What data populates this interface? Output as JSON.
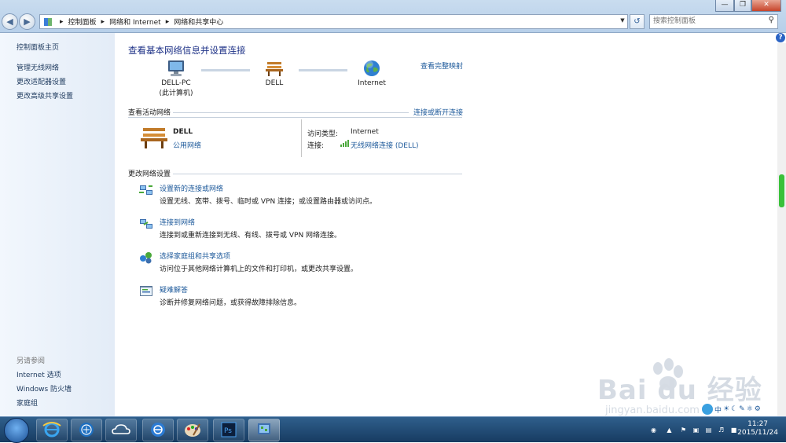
{
  "window": {
    "title_blurred": "网络和共享中心",
    "controls": [
      "—",
      "❐",
      "✕"
    ]
  },
  "address_bar": {
    "crumbs": [
      "控制面板",
      "网络和 Internet",
      "网络和共享中心"
    ],
    "search_placeholder": "搜索控制面板"
  },
  "left_pane": {
    "home": "控制面板主页",
    "links": [
      "管理无线网络",
      "更改适配器设置",
      "更改高级共享设置"
    ],
    "see_also_title": "另请参阅",
    "see_also": [
      "Internet 选项",
      "Windows 防火墙",
      "家庭组"
    ]
  },
  "main": {
    "title": "查看基本网络信息并设置连接",
    "full_map_link": "查看完整映射",
    "map_nodes": [
      {
        "label": "DELL-PC",
        "sublabel": "(此计算机)"
      },
      {
        "label": "DELL",
        "sublabel": ""
      },
      {
        "label": "Internet",
        "sublabel": ""
      }
    ],
    "active_header": "查看活动网络",
    "connect_link": "连接或断开连接",
    "network": {
      "name": "DELL",
      "type": "公用网络",
      "access_label": "访问类型:",
      "access_value": "Internet",
      "conn_label": "连接:",
      "conn_value": "无线网络连接 (DELL)"
    },
    "change_header": "更改网络设置",
    "tasks": [
      {
        "title": "设置新的连接或网络",
        "desc": "设置无线、宽带、拨号、临时或 VPN 连接；或设置路由器或访问点。"
      },
      {
        "title": "连接到网络",
        "desc": "连接到或重新连接到无线、有线、拨号或 VPN 网络连接。"
      },
      {
        "title": "选择家庭组和共享选项",
        "desc": "访问位于其他网络计算机上的文件和打印机，或更改共享设置。"
      },
      {
        "title": "疑难解答",
        "desc": "诊断并修复网络问题，或获得故障排除信息。"
      }
    ]
  },
  "taskbar": {
    "time": "11:27",
    "date": "2015/11/24",
    "ime": "中",
    "apps": [
      "start",
      "ie",
      "media",
      "cloud",
      "ie2",
      "paint",
      "photoshop",
      "control-panel"
    ]
  },
  "watermark": {
    "text": "Bai du 经验",
    "url": "jingyan.baidu.com"
  },
  "colors": {
    "link": "#1e5a9b",
    "title": "#1e3287",
    "scrollbar_thumb": "#3ac13a"
  }
}
